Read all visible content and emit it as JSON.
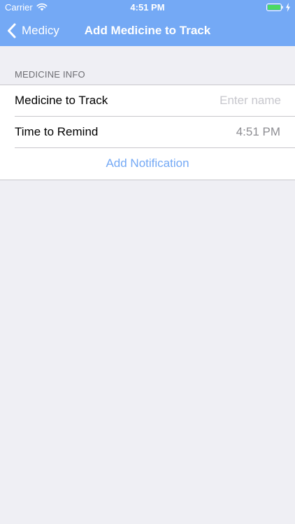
{
  "status_bar": {
    "carrier": "Carrier",
    "time": "4:51 PM"
  },
  "nav": {
    "back_label": "Medicy",
    "title": "Add Medicine to Track"
  },
  "section": {
    "header": "MEDICINE INFO"
  },
  "form": {
    "medicine_label": "Medicine to Track",
    "medicine_placeholder": "Enter name",
    "medicine_value": "",
    "time_label": "Time to Remind",
    "time_value": "4:51 PM",
    "add_button": "Add Notification"
  },
  "icons": {
    "wifi": "wifi-icon",
    "battery": "battery-icon",
    "charging": "charging-bolt-icon",
    "back": "chevron-left-icon"
  },
  "colors": {
    "nav_background": "#74a9f5",
    "accent": "#74a9f5",
    "battery_fill": "#4cd964",
    "page_background": "#efeff4"
  }
}
